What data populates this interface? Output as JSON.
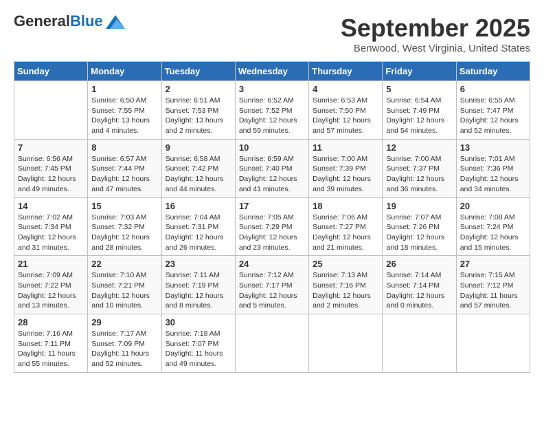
{
  "header": {
    "logo_general": "General",
    "logo_blue": "Blue",
    "month_title": "September 2025",
    "location": "Benwood, West Virginia, United States"
  },
  "days_of_week": [
    "Sunday",
    "Monday",
    "Tuesday",
    "Wednesday",
    "Thursday",
    "Friday",
    "Saturday"
  ],
  "weeks": [
    [
      {
        "day": "",
        "sunrise": "",
        "sunset": "",
        "daylight": ""
      },
      {
        "day": "1",
        "sunrise": "Sunrise: 6:50 AM",
        "sunset": "Sunset: 7:55 PM",
        "daylight": "Daylight: 13 hours and 4 minutes."
      },
      {
        "day": "2",
        "sunrise": "Sunrise: 6:51 AM",
        "sunset": "Sunset: 7:53 PM",
        "daylight": "Daylight: 13 hours and 2 minutes."
      },
      {
        "day": "3",
        "sunrise": "Sunrise: 6:52 AM",
        "sunset": "Sunset: 7:52 PM",
        "daylight": "Daylight: 12 hours and 59 minutes."
      },
      {
        "day": "4",
        "sunrise": "Sunrise: 6:53 AM",
        "sunset": "Sunset: 7:50 PM",
        "daylight": "Daylight: 12 hours and 57 minutes."
      },
      {
        "day": "5",
        "sunrise": "Sunrise: 6:54 AM",
        "sunset": "Sunset: 7:49 PM",
        "daylight": "Daylight: 12 hours and 54 minutes."
      },
      {
        "day": "6",
        "sunrise": "Sunrise: 6:55 AM",
        "sunset": "Sunset: 7:47 PM",
        "daylight": "Daylight: 12 hours and 52 minutes."
      }
    ],
    [
      {
        "day": "7",
        "sunrise": "Sunrise: 6:56 AM",
        "sunset": "Sunset: 7:45 PM",
        "daylight": "Daylight: 12 hours and 49 minutes."
      },
      {
        "day": "8",
        "sunrise": "Sunrise: 6:57 AM",
        "sunset": "Sunset: 7:44 PM",
        "daylight": "Daylight: 12 hours and 47 minutes."
      },
      {
        "day": "9",
        "sunrise": "Sunrise: 6:58 AM",
        "sunset": "Sunset: 7:42 PM",
        "daylight": "Daylight: 12 hours and 44 minutes."
      },
      {
        "day": "10",
        "sunrise": "Sunrise: 6:59 AM",
        "sunset": "Sunset: 7:40 PM",
        "daylight": "Daylight: 12 hours and 41 minutes."
      },
      {
        "day": "11",
        "sunrise": "Sunrise: 7:00 AM",
        "sunset": "Sunset: 7:39 PM",
        "daylight": "Daylight: 12 hours and 39 minutes."
      },
      {
        "day": "12",
        "sunrise": "Sunrise: 7:00 AM",
        "sunset": "Sunset: 7:37 PM",
        "daylight": "Daylight: 12 hours and 36 minutes."
      },
      {
        "day": "13",
        "sunrise": "Sunrise: 7:01 AM",
        "sunset": "Sunset: 7:36 PM",
        "daylight": "Daylight: 12 hours and 34 minutes."
      }
    ],
    [
      {
        "day": "14",
        "sunrise": "Sunrise: 7:02 AM",
        "sunset": "Sunset: 7:34 PM",
        "daylight": "Daylight: 12 hours and 31 minutes."
      },
      {
        "day": "15",
        "sunrise": "Sunrise: 7:03 AM",
        "sunset": "Sunset: 7:32 PM",
        "daylight": "Daylight: 12 hours and 28 minutes."
      },
      {
        "day": "16",
        "sunrise": "Sunrise: 7:04 AM",
        "sunset": "Sunset: 7:31 PM",
        "daylight": "Daylight: 12 hours and 26 minutes."
      },
      {
        "day": "17",
        "sunrise": "Sunrise: 7:05 AM",
        "sunset": "Sunset: 7:29 PM",
        "daylight": "Daylight: 12 hours and 23 minutes."
      },
      {
        "day": "18",
        "sunrise": "Sunrise: 7:06 AM",
        "sunset": "Sunset: 7:27 PM",
        "daylight": "Daylight: 12 hours and 21 minutes."
      },
      {
        "day": "19",
        "sunrise": "Sunrise: 7:07 AM",
        "sunset": "Sunset: 7:26 PM",
        "daylight": "Daylight: 12 hours and 18 minutes."
      },
      {
        "day": "20",
        "sunrise": "Sunrise: 7:08 AM",
        "sunset": "Sunset: 7:24 PM",
        "daylight": "Daylight: 12 hours and 15 minutes."
      }
    ],
    [
      {
        "day": "21",
        "sunrise": "Sunrise: 7:09 AM",
        "sunset": "Sunset: 7:22 PM",
        "daylight": "Daylight: 12 hours and 13 minutes."
      },
      {
        "day": "22",
        "sunrise": "Sunrise: 7:10 AM",
        "sunset": "Sunset: 7:21 PM",
        "daylight": "Daylight: 12 hours and 10 minutes."
      },
      {
        "day": "23",
        "sunrise": "Sunrise: 7:11 AM",
        "sunset": "Sunset: 7:19 PM",
        "daylight": "Daylight: 12 hours and 8 minutes."
      },
      {
        "day": "24",
        "sunrise": "Sunrise: 7:12 AM",
        "sunset": "Sunset: 7:17 PM",
        "daylight": "Daylight: 12 hours and 5 minutes."
      },
      {
        "day": "25",
        "sunrise": "Sunrise: 7:13 AM",
        "sunset": "Sunset: 7:16 PM",
        "daylight": "Daylight: 12 hours and 2 minutes."
      },
      {
        "day": "26",
        "sunrise": "Sunrise: 7:14 AM",
        "sunset": "Sunset: 7:14 PM",
        "daylight": "Daylight: 12 hours and 0 minutes."
      },
      {
        "day": "27",
        "sunrise": "Sunrise: 7:15 AM",
        "sunset": "Sunset: 7:12 PM",
        "daylight": "Daylight: 11 hours and 57 minutes."
      }
    ],
    [
      {
        "day": "28",
        "sunrise": "Sunrise: 7:16 AM",
        "sunset": "Sunset: 7:11 PM",
        "daylight": "Daylight: 11 hours and 55 minutes."
      },
      {
        "day": "29",
        "sunrise": "Sunrise: 7:17 AM",
        "sunset": "Sunset: 7:09 PM",
        "daylight": "Daylight: 11 hours and 52 minutes."
      },
      {
        "day": "30",
        "sunrise": "Sunrise: 7:18 AM",
        "sunset": "Sunset: 7:07 PM",
        "daylight": "Daylight: 11 hours and 49 minutes."
      },
      {
        "day": "",
        "sunrise": "",
        "sunset": "",
        "daylight": ""
      },
      {
        "day": "",
        "sunrise": "",
        "sunset": "",
        "daylight": ""
      },
      {
        "day": "",
        "sunrise": "",
        "sunset": "",
        "daylight": ""
      },
      {
        "day": "",
        "sunrise": "",
        "sunset": "",
        "daylight": ""
      }
    ]
  ]
}
